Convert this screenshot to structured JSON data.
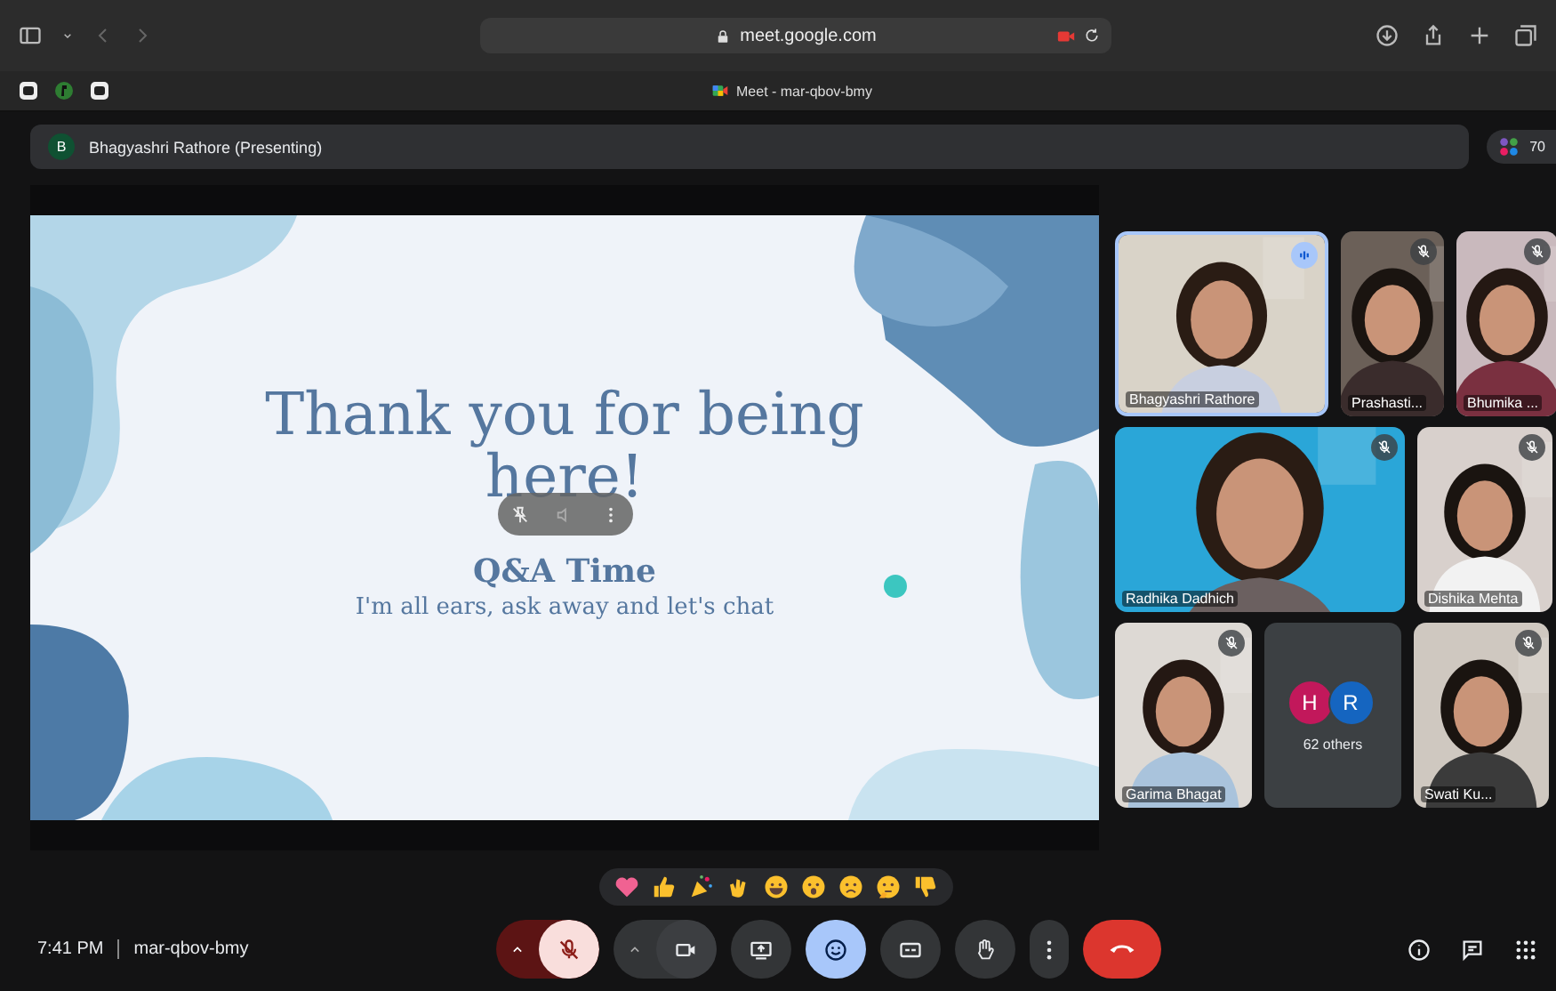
{
  "browser": {
    "url": "meet.google.com",
    "tab_title": "Meet - mar-qbov-bmy"
  },
  "presenter_bar": {
    "avatar": "B",
    "label": "Bhagyashri Rathore (Presenting)",
    "participant_count": "70"
  },
  "slide": {
    "title": "Thank you for being here!",
    "subtitle": "Q&A Time",
    "body": "I'm all ears,  ask away and let's chat"
  },
  "tiles": [
    {
      "kind": "video",
      "name": "Bhagyashri Rathore",
      "muted": false,
      "speaking": true
    },
    {
      "kind": "video",
      "name": "Prashasti...",
      "muted": true,
      "speaking": false
    },
    {
      "kind": "video",
      "name": "Bhumika ...",
      "muted": true,
      "speaking": false
    },
    {
      "kind": "video",
      "name": "Radhika Dadhich",
      "muted": true,
      "speaking": false
    },
    {
      "kind": "video",
      "name": "Dishika Mehta",
      "muted": true,
      "speaking": false
    },
    {
      "kind": "video",
      "name": "Garima Bhagat",
      "muted": true,
      "speaking": false
    },
    {
      "kind": "others",
      "label": "62 others",
      "avatars": [
        {
          "letter": "H",
          "color": "#c2185b"
        },
        {
          "letter": "R",
          "color": "#1565c0"
        }
      ]
    },
    {
      "kind": "video",
      "name": "Swati Ku...",
      "muted": true,
      "speaking": false
    }
  ],
  "reactions": [
    {
      "kind": "heart"
    },
    {
      "kind": "thumbs-up"
    },
    {
      "kind": "party"
    },
    {
      "kind": "clap"
    },
    {
      "kind": "laugh"
    },
    {
      "kind": "surprised"
    },
    {
      "kind": "sad"
    },
    {
      "kind": "thinking"
    },
    {
      "kind": "thumbs-down"
    }
  ],
  "footer": {
    "time": "7:41 PM",
    "meeting_code": "mar-qbov-bmy"
  },
  "controls": [
    {
      "kind": "mic",
      "off": true
    },
    {
      "kind": "camera",
      "off": false
    },
    {
      "kind": "present",
      "off": false
    },
    {
      "kind": "reactions",
      "selected": true
    },
    {
      "kind": "captions",
      "selected": false
    },
    {
      "kind": "hand",
      "selected": false
    },
    {
      "kind": "more"
    },
    {
      "kind": "leave"
    }
  ]
}
